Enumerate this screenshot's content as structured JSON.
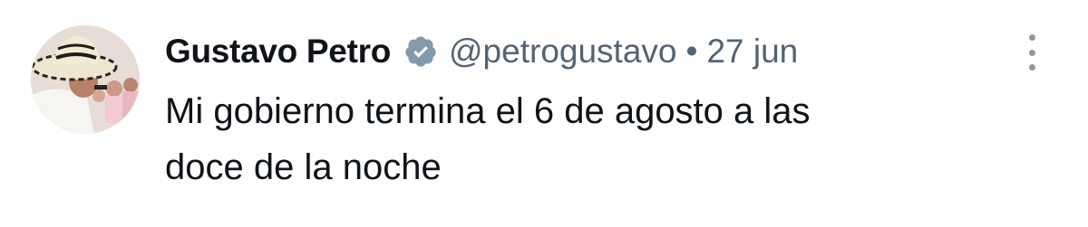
{
  "tweet": {
    "author": {
      "name": "Gustavo Petro",
      "handle": "@petrogustavo",
      "verified": true
    },
    "separator": "•",
    "date": "27 jun",
    "text": "Mi gobierno termina el 6 de agosto a las\ndoce de la noche"
  },
  "colors": {
    "verified_badge": "#829aab",
    "name_text": "#0f1419",
    "secondary_text": "#536471"
  },
  "icons": {
    "verified": "verified-badge-icon",
    "more": "more-options-icon"
  }
}
